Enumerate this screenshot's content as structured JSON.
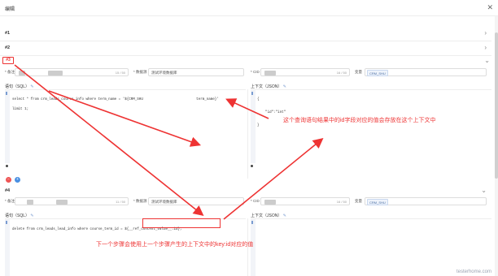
{
  "title": "编辑",
  "steps": [
    {
      "label": "#1"
    },
    {
      "label": "#2"
    },
    {
      "label": "#3"
    },
    {
      "label": "#4"
    }
  ],
  "step3": {
    "remark_label": "* 备注",
    "remark_count": "15 / 50",
    "datasource_label": "* 数据源",
    "datasource_value": "测试环境数据库",
    "code_label": "* CID",
    "code_count": "16 / 50",
    "variable_label": "变量",
    "variable_tag": "CRM_SHU",
    "sql_header": "语句（SQL）",
    "context_header": "上下文（JSON）",
    "sql_lines": [
      "select * from crm_leads_course_info where term_name = '${CRM_SHU                          term_name}'",
      "limit 1;"
    ],
    "json_lines": [
      "{",
      "    \"id\":\"int\"",
      "}"
    ]
  },
  "step4": {
    "remark_label": "* 备注",
    "remark_count": "11 / 50",
    "datasource_label": "* 数据源",
    "datasource_value": "测试环境数据库",
    "code_label": "* CID",
    "code_count": "16 / 50",
    "variable_label": "变量",
    "variable_tag": "CRM_SHU",
    "sql_header": "语句（SQL）",
    "context_header": "上下文（JSON）",
    "sql_lines": [
      "delete from crm_leads_lead_info where course_term_id = ${__ref_context_value__.id};"
    ],
    "sql_highlight": "${__ref_context_value__.id};"
  },
  "annotations": {
    "right_note": "这个查询语句结果中的id字段对应的值会存放在这个上下文中",
    "bottom_note": "下一个步骤会使用上一个步骤产生的上下文中的key:id对应的值"
  },
  "buttons": {
    "delete": "−",
    "add": "+"
  },
  "watermark": "testerhome.com",
  "colors": {
    "annotation": "#ee3333",
    "accent": "#7a9cd1"
  }
}
